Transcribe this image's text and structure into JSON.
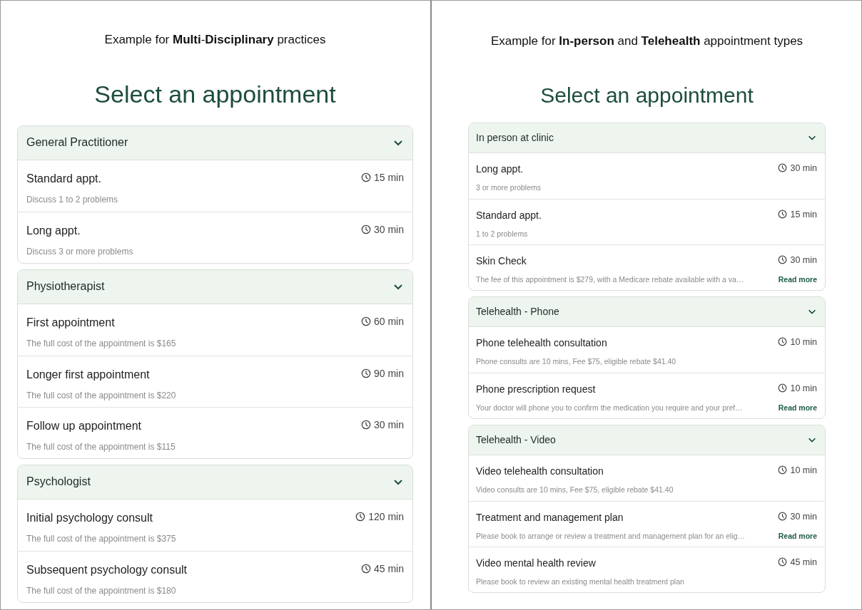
{
  "panels": [
    {
      "caption": "Example for **Multi**-**Disciplinary** practices",
      "heading": "Select an appointment",
      "groups": [
        {
          "title": "General Practitioner",
          "expanded": true,
          "items": [
            {
              "title": "Standard appt.",
              "duration": "15 min",
              "description": "Discuss 1 to 2 problems"
            },
            {
              "title": "Long appt.",
              "duration": "30 min",
              "description": "Discuss 3 or more problems"
            }
          ]
        },
        {
          "title": "Physiotherapist",
          "expanded": true,
          "items": [
            {
              "title": "First appointment",
              "duration": "60 min",
              "description": "The full cost of the appointment is $165"
            },
            {
              "title": "Longer first appointment",
              "duration": "90 min",
              "description": "The full cost of the appointment is $220"
            },
            {
              "title": "Follow up appointment",
              "duration": "30 min",
              "description": "The full cost of the appointment is $115"
            }
          ]
        },
        {
          "title": "Psychologist",
          "expanded": true,
          "items": [
            {
              "title": "Initial psychology consult",
              "duration": "120 min",
              "description": "The full cost of the appointment is $375"
            },
            {
              "title": "Subsequent psychology consult",
              "duration": "45 min",
              "description": "The full cost of the appointment is $180"
            }
          ]
        }
      ]
    },
    {
      "caption": "Example for **In-person** and **Telehealth** appointment types",
      "heading": "Select an appointment",
      "groups": [
        {
          "title": "In person at clinic",
          "expanded": true,
          "items": [
            {
              "title": "Long appt.",
              "duration": "30 min",
              "description": "3 or more problems"
            },
            {
              "title": "Standard appt.",
              "duration": "15 min",
              "description": "1 to 2 problems"
            },
            {
              "title": "Skin Check",
              "duration": "30 min",
              "description": "The fee of this appointment is $279, with a Medicare rebate available with a va…",
              "link": "Read more"
            }
          ]
        },
        {
          "title": "Telehealth - Phone",
          "expanded": true,
          "items": [
            {
              "title": "Phone telehealth consultation",
              "duration": "10 min",
              "description": "Phone consults are 10 mins, Fee $75, eligible rebate $41.40"
            },
            {
              "title": "Phone prescription request",
              "duration": "10 min",
              "description": "Your doctor will phone you to confirm the medication you require and your pref…",
              "link": "Read more"
            }
          ]
        },
        {
          "title": "Telehealth - Video",
          "expanded": true,
          "items": [
            {
              "title": "Video telehealth consultation",
              "duration": "10 min",
              "description": "Video consults are 10 mins, Fee $75, eligible rebate $41.40"
            },
            {
              "title": "Treatment and management plan",
              "duration": "30 min",
              "description": "Please book to arrange or review a treatment and management plan for an elig…",
              "link": "Read more"
            },
            {
              "title": "Video mental health review",
              "duration": "45 min",
              "description": "Please book to review an existing mental health treatment plan"
            }
          ]
        }
      ]
    }
  ]
}
